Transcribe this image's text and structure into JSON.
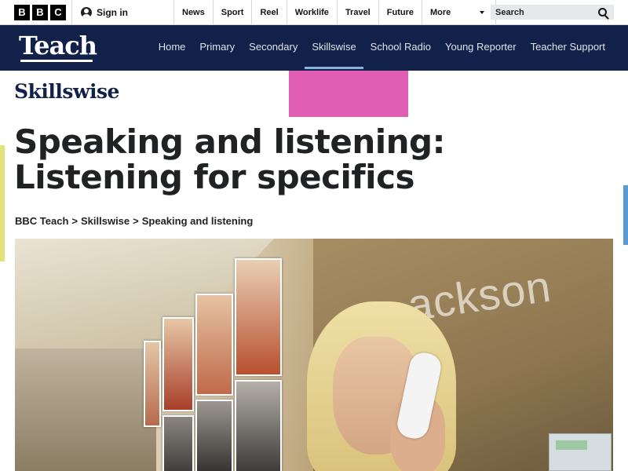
{
  "topbar": {
    "logo": [
      "B",
      "B",
      "C"
    ],
    "signin_label": "Sign in",
    "nav": [
      "News",
      "Sport",
      "Reel",
      "Worklife",
      "Travel",
      "Future"
    ],
    "more_label": "More",
    "search_placeholder": "Search"
  },
  "teach": {
    "logo": "Teach",
    "nav": [
      "Home",
      "Primary",
      "Secondary",
      "Skillswise",
      "School Radio",
      "Young Reporter",
      "Teacher Support"
    ],
    "active": "Skillswise"
  },
  "page": {
    "brand": "Skillswise",
    "title": "Speaking and listening: Listening for specifics",
    "breadcrumb": [
      "BBC Teach",
      "Skillswise",
      "Speaking and listening"
    ],
    "breadcrumb_sep": ">"
  },
  "video": {
    "sign_text": "ackson"
  },
  "colors": {
    "teach_bar": "#122149",
    "pink_block": "#e05fb5",
    "active_underline": "#8ab1d9"
  }
}
